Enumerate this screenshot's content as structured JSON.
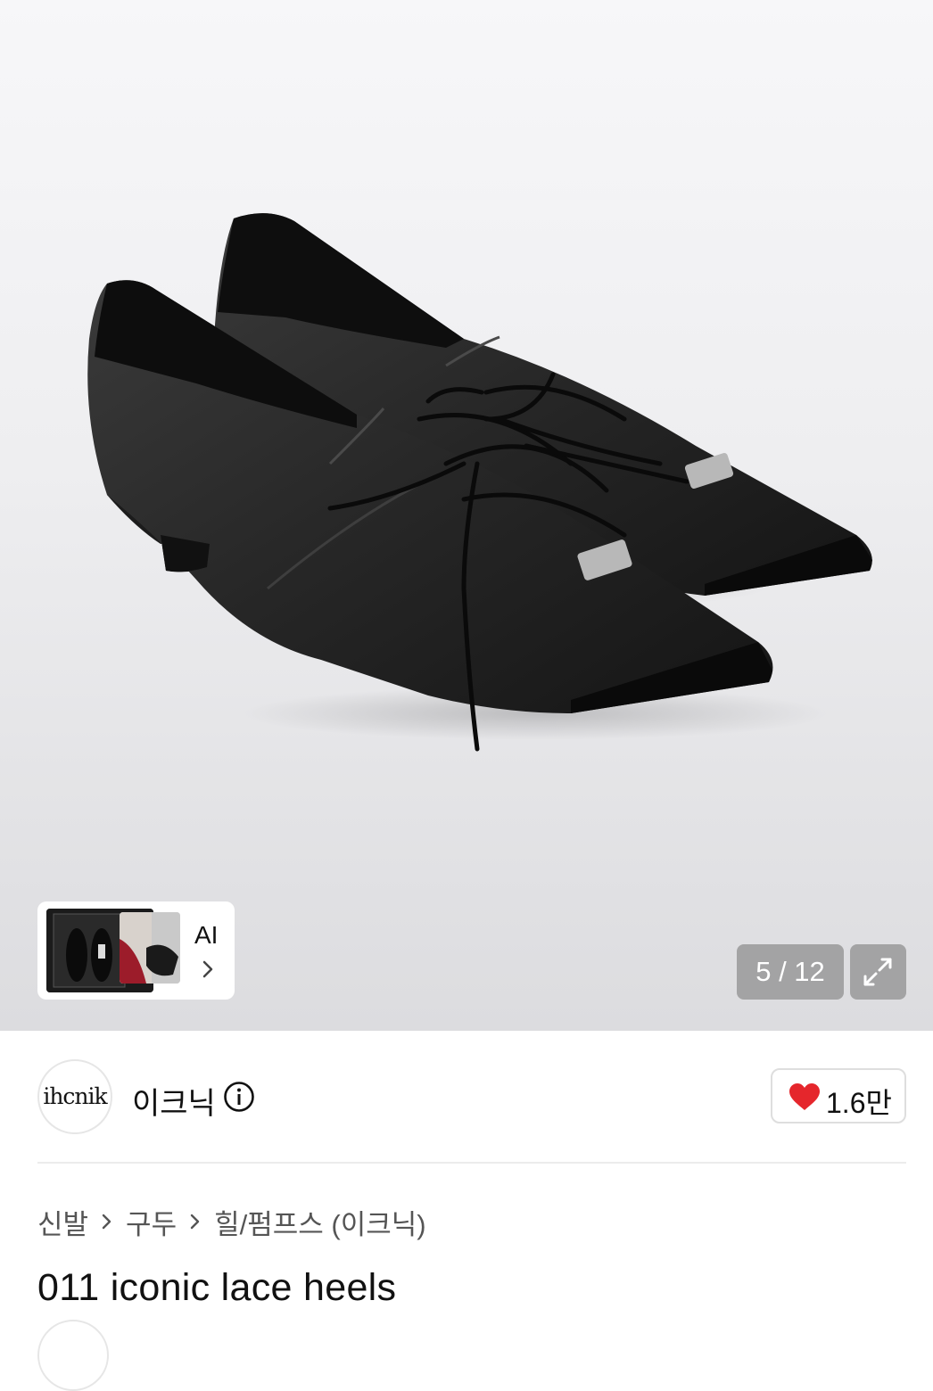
{
  "gallery": {
    "counter_text": "5 / 12",
    "ai_card_label": "AI"
  },
  "brand": {
    "logo_text": "ihcnik",
    "name": "이크닉",
    "like_count": "1.6만",
    "heart_color": "#e5262c"
  },
  "breadcrumb": [
    "신발",
    "구두",
    "힐/펌프스 (이크닉)"
  ],
  "product": {
    "title": "011 iconic lace heels"
  }
}
